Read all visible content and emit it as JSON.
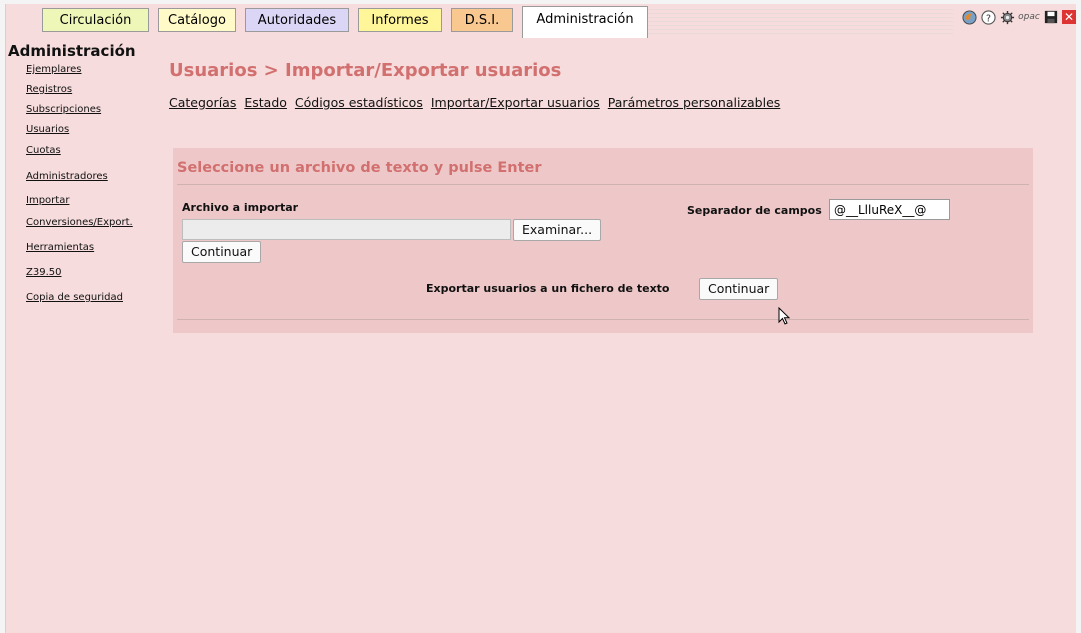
{
  "tabs": [
    {
      "label": "Circulación",
      "color": "#eef7b8"
    },
    {
      "label": "Catálogo",
      "color": "#fffac8"
    },
    {
      "label": "Autoridades",
      "color": "#dcd6f6"
    },
    {
      "label": "Informes",
      "color": "#fff69a"
    },
    {
      "label": "D.S.I.",
      "color": "#f9c890"
    },
    {
      "label": "Administración",
      "color": "#ffffff",
      "active": true
    }
  ],
  "toolbar": {
    "icons": [
      "firefox-icon",
      "help-icon",
      "settings-icon",
      "opac-icon",
      "save-icon",
      "close-icon"
    ],
    "opac_label": "opac"
  },
  "leftmenu": {
    "title": "Administración",
    "items": [
      {
        "label": "Ejemplares"
      },
      {
        "label": "Registros"
      },
      {
        "label": "Subscripciones"
      },
      {
        "label": "Usuarios"
      },
      {
        "label": "Cuotas"
      },
      {
        "label": "Administradores"
      },
      {
        "label": "Importar"
      },
      {
        "label": "Conversiones/Export."
      },
      {
        "label": "Herramientas"
      },
      {
        "label": "Z39.50"
      },
      {
        "label": "Copia de seguridad"
      }
    ]
  },
  "main": {
    "title": "Usuarios > Importar/Exportar usuarios",
    "sublinks": [
      "Categorías",
      "Estado",
      "Códigos estadísticos",
      "Importar/Exportar usuarios",
      "Parámetros personalizables"
    ]
  },
  "panel": {
    "title": "Seleccione un archivo de texto y pulse Enter",
    "file_label": "Archivo a importar",
    "file_value": "",
    "browse_label": "Examinar...",
    "continue_label": "Continuar",
    "separator_label": "Separador de campos",
    "separator_value": "@__LlluReX__@",
    "export_label": "Exportar usuarios a un fichero de texto",
    "export_button": "Continuar"
  },
  "colors": {
    "background": "#f6dcdc",
    "panel": "#eec8c8",
    "title": "#d27070"
  }
}
